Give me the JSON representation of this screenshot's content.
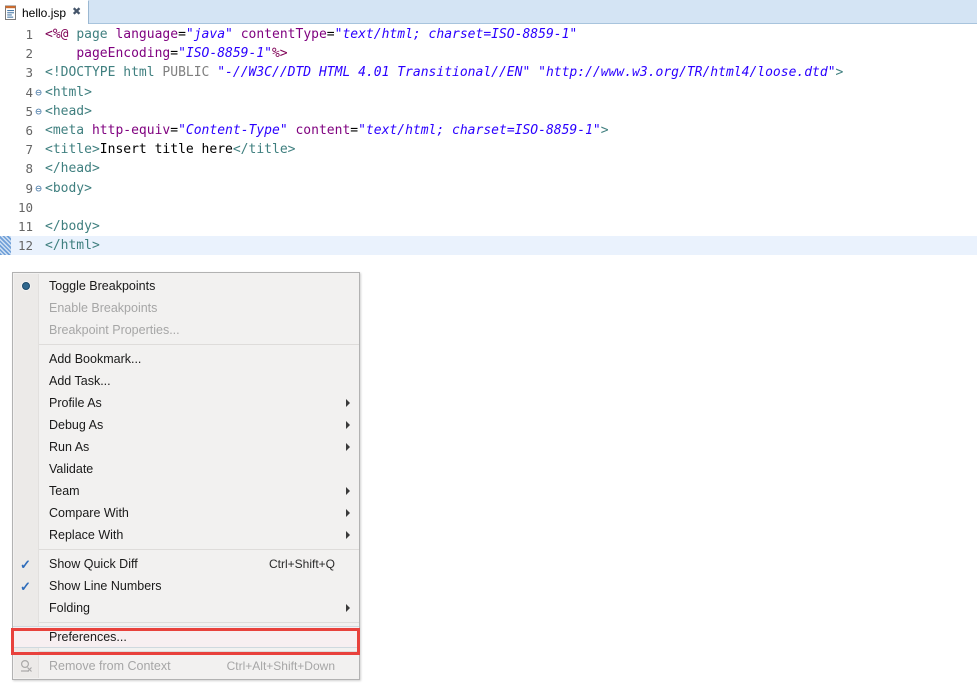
{
  "window": {
    "app": "Eclipse IDE",
    "accent_color": "#2f6dbb",
    "highlight_box_color": "#e8413c"
  },
  "tab": {
    "label": "hello.jsp",
    "close_glyph": "✖",
    "icon": "jsp-file-icon"
  },
  "editor": {
    "language": "jsp",
    "active_line": 12,
    "total_lines": 12,
    "lines": [
      {
        "num": "1",
        "fold": "",
        "text": "<%@ page language=\"java\" contentType=\"text/html; charset=ISO-8859-1\""
      },
      {
        "num": "2",
        "fold": "",
        "text": "    pageEncoding=\"ISO-8859-1\"%>"
      },
      {
        "num": "3",
        "fold": "",
        "text": "<!DOCTYPE html PUBLIC \"-//W3C//DTD HTML 4.01 Transitional//EN\" \"http://www.w3.org/TR/html4/loose.dtd\">"
      },
      {
        "num": "4",
        "fold": "⊖",
        "text": "<html>"
      },
      {
        "num": "5",
        "fold": "⊖",
        "text": "<head>"
      },
      {
        "num": "6",
        "fold": "",
        "text": "<meta http-equiv=\"Content-Type\" content=\"text/html; charset=ISO-8859-1\">"
      },
      {
        "num": "7",
        "fold": "",
        "text": "<title>Insert title here</title>"
      },
      {
        "num": "8",
        "fold": "",
        "text": "</head>"
      },
      {
        "num": "9",
        "fold": "⊖",
        "text": "<body>"
      },
      {
        "num": "10",
        "fold": "",
        "text": ""
      },
      {
        "num": "11",
        "fold": "",
        "text": "</body>"
      },
      {
        "num": "12",
        "fold": "",
        "text": "</html>"
      }
    ]
  },
  "context_menu": {
    "selected_item": "Preferences...",
    "items": [
      {
        "label": "Toggle Breakpoints",
        "icon": "breakpoint-icon",
        "accel": "",
        "arrow": false,
        "check": false,
        "disabled": false,
        "sep_after": false
      },
      {
        "label": "Enable Breakpoints",
        "icon": "",
        "accel": "",
        "arrow": false,
        "check": false,
        "disabled": true,
        "sep_after": false
      },
      {
        "label": "Breakpoint Properties...",
        "icon": "",
        "accel": "",
        "arrow": false,
        "check": false,
        "disabled": true,
        "sep_after": true
      },
      {
        "label": "Add Bookmark...",
        "icon": "",
        "accel": "",
        "arrow": false,
        "check": false,
        "disabled": false,
        "sep_after": false
      },
      {
        "label": "Add Task...",
        "icon": "",
        "accel": "",
        "arrow": false,
        "check": false,
        "disabled": false,
        "sep_after": false
      },
      {
        "label": "Profile As",
        "icon": "",
        "accel": "",
        "arrow": true,
        "check": false,
        "disabled": false,
        "sep_after": false
      },
      {
        "label": "Debug As",
        "icon": "",
        "accel": "",
        "arrow": true,
        "check": false,
        "disabled": false,
        "sep_after": false
      },
      {
        "label": "Run As",
        "icon": "",
        "accel": "",
        "arrow": true,
        "check": false,
        "disabled": false,
        "sep_after": false
      },
      {
        "label": "Validate",
        "icon": "",
        "accel": "",
        "arrow": false,
        "check": false,
        "disabled": false,
        "sep_after": false
      },
      {
        "label": "Team",
        "icon": "",
        "accel": "",
        "arrow": true,
        "check": false,
        "disabled": false,
        "sep_after": false
      },
      {
        "label": "Compare With",
        "icon": "",
        "accel": "",
        "arrow": true,
        "check": false,
        "disabled": false,
        "sep_after": false
      },
      {
        "label": "Replace With",
        "icon": "",
        "accel": "",
        "arrow": true,
        "check": false,
        "disabled": false,
        "sep_after": true
      },
      {
        "label": "Show Quick Diff",
        "icon": "",
        "accel": "Ctrl+Shift+Q",
        "arrow": false,
        "check": true,
        "disabled": false,
        "sep_after": false
      },
      {
        "label": "Show Line Numbers",
        "icon": "",
        "accel": "",
        "arrow": false,
        "check": true,
        "disabled": false,
        "sep_after": false
      },
      {
        "label": "Folding",
        "icon": "",
        "accel": "",
        "arrow": true,
        "check": false,
        "disabled": false,
        "sep_after": true
      },
      {
        "label": "Preferences...",
        "icon": "",
        "accel": "",
        "arrow": false,
        "check": false,
        "disabled": false,
        "sep_after": true,
        "selected": true
      },
      {
        "label": "Remove from Context",
        "icon": "remove-from-context-icon",
        "accel": "Ctrl+Alt+Shift+Down",
        "arrow": false,
        "check": false,
        "disabled": true,
        "sep_after": false
      }
    ]
  }
}
